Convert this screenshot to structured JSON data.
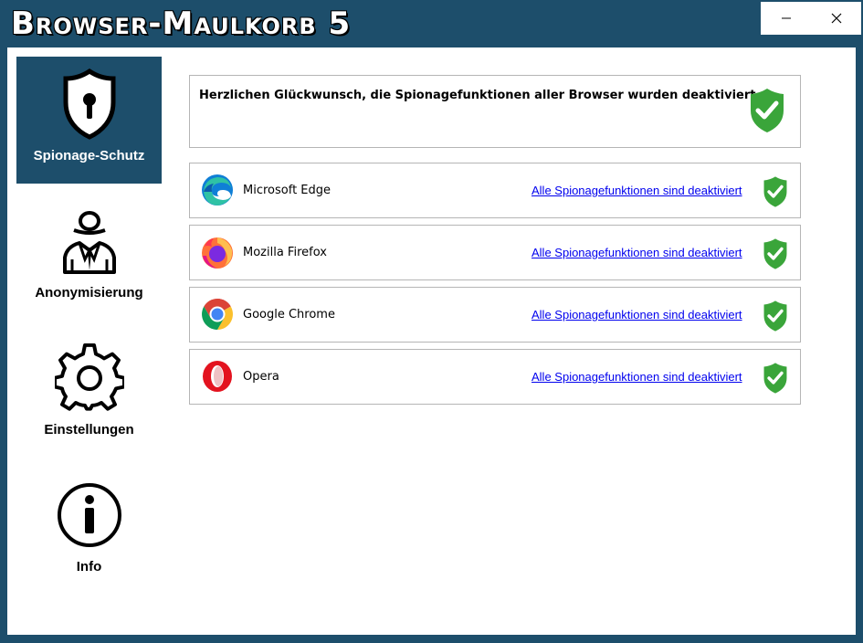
{
  "app": {
    "title": "Browser-Maulkorb 5"
  },
  "window_controls": {
    "minimize_icon": "minimize-icon",
    "close_icon": "close-icon"
  },
  "sidebar": {
    "items": [
      {
        "label": "Spionage-Schutz",
        "icon": "shield-keyhole-icon",
        "active": true
      },
      {
        "label": "Anonymisierung",
        "icon": "anonymous-person-icon",
        "active": false
      },
      {
        "label": "Einstellungen",
        "icon": "gear-icon",
        "active": false
      },
      {
        "label": "Info",
        "icon": "info-icon",
        "active": false
      }
    ]
  },
  "main": {
    "banner": {
      "message": "Herzlichen Glückwunsch, die Spionagefunktionen aller Browser wurden deaktiviert.",
      "icon": "green-check-shield-icon"
    },
    "browsers": [
      {
        "name": "Microsoft Edge",
        "status": "Alle Spionagefunktionen sind deaktiviert",
        "icon": "edge-logo"
      },
      {
        "name": "Mozilla Firefox",
        "status": "Alle Spionagefunktionen sind deaktiviert",
        "icon": "firefox-logo"
      },
      {
        "name": "Google Chrome",
        "status": "Alle Spionagefunktionen sind deaktiviert",
        "icon": "chrome-logo"
      },
      {
        "name": "Opera",
        "status": "Alle Spionagefunktionen sind deaktiviert",
        "icon": "opera-logo"
      }
    ]
  },
  "colors": {
    "frame": "#1d4e6b",
    "shield_green": "#3aa53a",
    "link": "#0000ee"
  }
}
